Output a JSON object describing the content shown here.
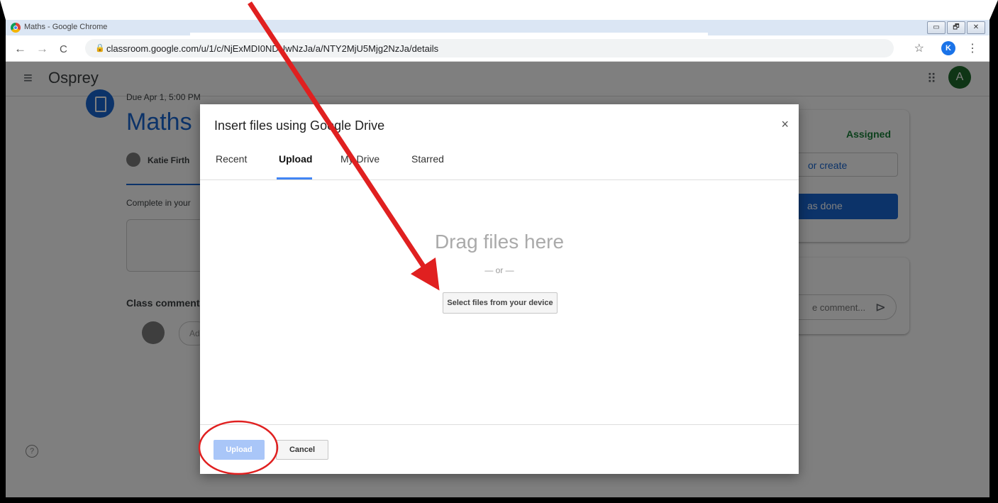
{
  "window": {
    "title": "Maths - Google Chrome",
    "buttons": [
      "▭",
      "🗗",
      "✕"
    ]
  },
  "browser": {
    "url": "classroom.google.com/u/1/c/NjExMDI0NDUwNzJa/a/NTY2MjU5Mjg2NzJa/details",
    "profile_initial": "K",
    "back_icon": "←",
    "forward_icon": "→",
    "reload_icon": "C",
    "lock_icon": "🔒",
    "star_icon": "☆",
    "menu_icon": "⋮"
  },
  "classroom": {
    "class_name": "Osprey",
    "user_initial": "A",
    "assignment": {
      "due": "Due Apr 1, 5:00 PM",
      "title": "Maths",
      "teacher": "Katie Firth",
      "instructions": "Complete in your",
      "class_comments": "Class comments",
      "comment_placeholder": "Ad"
    },
    "work_card": {
      "status": "Assigned",
      "add_create": "or create",
      "mark_done": "as done"
    },
    "private_comment_placeholder": "e comment...",
    "help": "?"
  },
  "dialog": {
    "title": "Insert files using Google Drive",
    "close": "×",
    "tabs": [
      {
        "label": "Recent"
      },
      {
        "label": "Upload"
      },
      {
        "label": "My Drive"
      },
      {
        "label": "Starred"
      }
    ],
    "drag_text": "Drag files here",
    "or_text": "— or —",
    "select_button": "Select files from your device",
    "upload_button": "Upload",
    "cancel_button": "Cancel"
  },
  "colors": {
    "annotation": "#e02020",
    "classroom_blue": "#1967d2",
    "assigned_green": "#188038"
  }
}
